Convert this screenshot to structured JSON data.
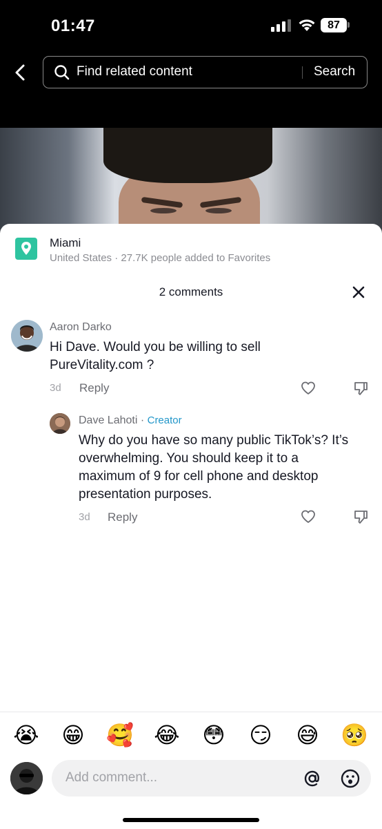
{
  "status_bar": {
    "time": "01:47",
    "battery": "87"
  },
  "search": {
    "placeholder": "Find related content",
    "button_label": "Search"
  },
  "location": {
    "name": "Miami",
    "subtitle": "United States · 27.7K people added to Favorites"
  },
  "comments": {
    "title": "2 comments",
    "items": [
      {
        "username": "Aaron Darko",
        "text_line1": "Hi Dave. Would you be willing to sell",
        "text_line2": "PureVitality.com ?",
        "time": "3d",
        "reply_label": "Reply"
      }
    ],
    "reply": {
      "username": "Dave Lahoti",
      "separator": " · ",
      "badge": "Creator",
      "text_line1": "Why do you have so many public TikTok’s? It’s",
      "text_line2": "overwhelming. You should keep it to a",
      "text_line3": "maximum of 9 for cell phone and desktop",
      "text_line4": "presentation purposes.",
      "time": "3d",
      "reply_label": "Reply"
    }
  },
  "emoji_bar": [
    "😭",
    "😁",
    "🥰",
    "😂",
    "😳",
    "😏",
    "😅",
    "🥺"
  ],
  "composer": {
    "placeholder": "Add comment..."
  },
  "colors": {
    "accent_creator": "#2196c9",
    "location_icon": "#2ec4a0"
  }
}
